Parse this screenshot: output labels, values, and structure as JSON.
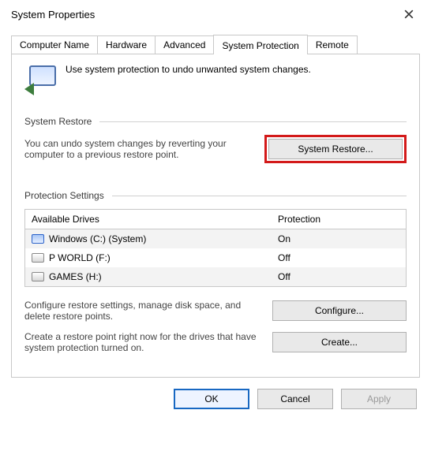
{
  "title": "System Properties",
  "tabs": [
    "Computer Name",
    "Hardware",
    "Advanced",
    "System Protection",
    "Remote"
  ],
  "active_tab": 3,
  "intro": "Use system protection to undo unwanted system changes.",
  "restore": {
    "heading": "System Restore",
    "desc": "You can undo system changes by reverting your computer to a previous restore point.",
    "button": "System Restore..."
  },
  "protection": {
    "heading": "Protection Settings",
    "col_drive": "Available Drives",
    "col_prot": "Protection",
    "rows": [
      {
        "name": "Windows (C:) (System)",
        "prot": "On",
        "kind": "win"
      },
      {
        "name": "P WORLD (F:)",
        "prot": "Off",
        "kind": "hdd"
      },
      {
        "name": "GAMES (H:)",
        "prot": "Off",
        "kind": "hdd"
      }
    ],
    "configure_desc": "Configure restore settings, manage disk space, and delete restore points.",
    "configure_btn": "Configure...",
    "create_desc": "Create a restore point right now for the drives that have system protection turned on.",
    "create_btn": "Create..."
  },
  "footer": {
    "ok": "OK",
    "cancel": "Cancel",
    "apply": "Apply"
  }
}
